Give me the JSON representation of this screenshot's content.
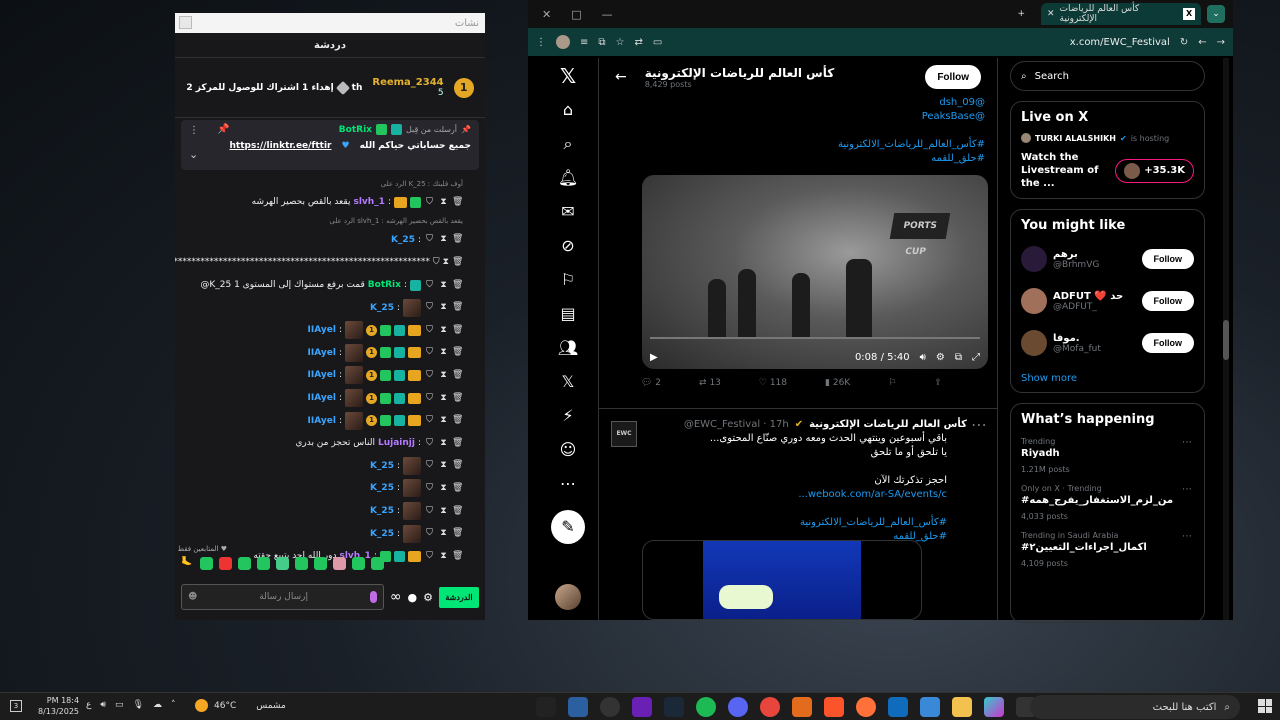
{
  "chat": {
    "title": "دردشة",
    "window_label": "نشات",
    "goal_text": "إهداء 1 اشتراك للوصول للمركز 2",
    "goal_suffix": "th",
    "top_user": "Reema_2344",
    "top_user_count": "5",
    "top_rank": "1",
    "pinned": {
      "pinned_by": "أرسلت من قِبل",
      "author": "BotRix",
      "message": "جميع حساباتي حياكم الله",
      "link": "https://linktr.ee/fttir"
    },
    "messages": [
      {
        "type": "reply",
        "text": "الرد على K_25 : أوف قلبتك"
      },
      {
        "type": "msg",
        "name": "slvh_1",
        "name_color": "#b57aff",
        "text": "يقعد بالقص بحصير الهرشه",
        "badges": [
          "green",
          "crown"
        ]
      },
      {
        "type": "reply",
        "text": "الرد على slvh_1 : يقعد بالقص بحصير الهرشه"
      },
      {
        "type": "msg",
        "name": "K_25",
        "name_color": "#3ba5ff",
        "text": "",
        "badges": []
      },
      {
        "type": "msg",
        "name": "",
        "name_color": "#fff",
        "text": "*****************************************************************",
        "badges": []
      },
      {
        "type": "msg",
        "name": "BotRix",
        "name_color": "#00e676",
        "text": "@K_25 قمت برفع مستواك إلى المستوى 1",
        "badges": [
          "teal"
        ]
      },
      {
        "type": "msg",
        "name": "K_25",
        "name_color": "#3ba5ff",
        "text": "",
        "badges": [
          "thumb"
        ]
      },
      {
        "type": "msg",
        "name": "IIAyel",
        "name_color": "#3ba5ff",
        "text": "",
        "badges": [
          "crown",
          "teal",
          "green",
          "one",
          "thumb"
        ]
      },
      {
        "type": "msg",
        "name": "IIAyel",
        "name_color": "#3ba5ff",
        "text": "",
        "badges": [
          "crown",
          "teal",
          "green",
          "one",
          "thumb"
        ]
      },
      {
        "type": "msg",
        "name": "IIAyel",
        "name_color": "#3ba5ff",
        "text": "",
        "badges": [
          "crown",
          "teal",
          "green",
          "one",
          "thumb"
        ]
      },
      {
        "type": "msg",
        "name": "IIAyel",
        "name_color": "#3ba5ff",
        "text": "",
        "badges": [
          "crown",
          "teal",
          "green",
          "one",
          "thumb"
        ]
      },
      {
        "type": "msg",
        "name": "IIAyel",
        "name_color": "#3ba5ff",
        "text": "",
        "badges": [
          "crown",
          "teal",
          "green",
          "one",
          "thumb"
        ]
      },
      {
        "type": "msg",
        "name": "Lujainjj",
        "name_color": "#b57aff",
        "text": "الناس تحجز من بدري",
        "badges": []
      },
      {
        "type": "msg",
        "name": "K_25",
        "name_color": "#3ba5ff",
        "text": "",
        "badges": [
          "thumb"
        ]
      },
      {
        "type": "msg",
        "name": "K_25",
        "name_color": "#3ba5ff",
        "text": "",
        "badges": [
          "thumb"
        ]
      },
      {
        "type": "msg",
        "name": "K_25",
        "name_color": "#3ba5ff",
        "text": "",
        "badges": [
          "thumb"
        ]
      },
      {
        "type": "msg",
        "name": "K_25",
        "name_color": "#3ba5ff",
        "text": "",
        "badges": [
          "thumb"
        ]
      },
      {
        "type": "msg",
        "name": "slvh_1",
        "name_color": "#b57aff",
        "text": "دور الله احد بتبيع حقته",
        "badges": [
          "crown",
          "teal",
          "green"
        ]
      }
    ],
    "followers_only": "المتابعين فقط",
    "input_placeholder": "إرسال رسالة",
    "send_label": "الدردشة"
  },
  "browser": {
    "tab_title": "كأس العالم للرياضات الإلكترونية",
    "url": "x.com/EWC_Festival"
  },
  "x": {
    "profile_name": "كأس العالم للرياضات الإلكترونية",
    "profile_posts": "8,429 posts",
    "follow_label": "Follow",
    "tweet1_lines": [
      "@dsh_09",
      "@PeaksBase",
      "",
      "#كأس_العالم_للرياضات_الالكترونية",
      "#حلق_للقمه"
    ],
    "video_time": "0:08 / 5:40",
    "video_sign": "PORTS CUP",
    "actions": [
      "2",
      "13",
      "118",
      "26K"
    ],
    "tweet2": {
      "name": "كأس العالم للرياضات الإلكترونية",
      "handle": "@EWC_Festival · 17h",
      "avatar_text": "EWC",
      "lines": [
        "باقي أسبوعين وينتهي الحدث ومعه دوري صنّاع المحتوى...",
        "يا تلحق أو ما تلحق",
        "",
        "احجز تذكرتك الآن",
        "webook.com/ar-SA/events/c...",
        "",
        "#كأس_العالم_للرياضات_الالكترونية",
        "#حلق_للقمه"
      ]
    },
    "search_placeholder": "Search",
    "live": {
      "title": "Live on X",
      "host": "TURKI ALALSHIKH",
      "hosting": "is hosting",
      "watch": "Watch the Livestream of the ...",
      "count": "+35.3K"
    },
    "might_like": {
      "title": "You might like",
      "users": [
        {
          "name": "برهم",
          "handle": "@BrhmVG",
          "color": "#2a1a3a"
        },
        {
          "name": "ADFUT ❤️ حد",
          "handle": "@ADFUT_",
          "color": "#a0705a"
        },
        {
          "name": "موفا.",
          "handle": "@Mofa_fut",
          "color": "#6a4a30"
        }
      ],
      "follow_label": "Follow",
      "show_more": "Show more"
    },
    "happening": {
      "title": "What’s happening",
      "trends": [
        {
          "cat": "Trending",
          "name": "Riyadh",
          "count": "1.21M posts"
        },
        {
          "cat": "Only on X · Trending",
          "name": "#من_لزم_الاستغفار_يفرج_همه",
          "count": "4,033 posts"
        },
        {
          "cat": "Trending in Saudi Arabia",
          "name": "#اكمال_اجراءات_التعيين٢",
          "count": "4,109 posts"
        }
      ]
    }
  },
  "taskbar": {
    "search_placeholder": "اكتب هنا للبحث",
    "weather_temp": "46°C",
    "weather_label": "مشمس",
    "time": "PM 18:4",
    "date": "8/13/2025",
    "notif_count": "3",
    "lang": "ع"
  }
}
